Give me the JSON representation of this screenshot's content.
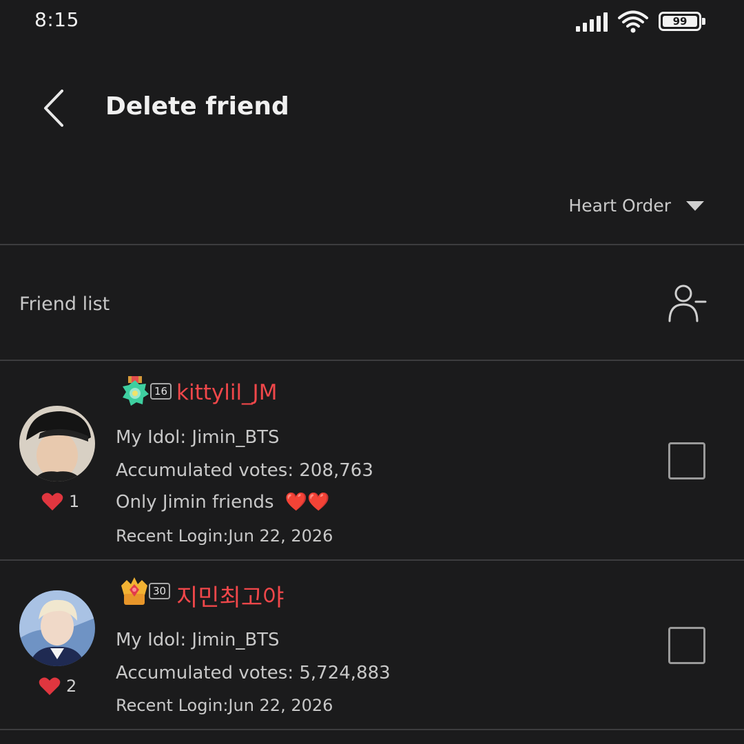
{
  "status_bar": {
    "time": "8:15",
    "battery": "99"
  },
  "header": {
    "title": "Delete friend"
  },
  "sort": {
    "label": "Heart Order"
  },
  "section": {
    "label": "Friend list"
  },
  "friends": [
    {
      "level": "16",
      "username": "kittylil_JM",
      "idol": "My Idol: Jimin_BTS",
      "votes": "Accumulated votes: 208,763",
      "status_message": "Only Jimin friends",
      "status_emoji": "❤️❤️",
      "recent_login": "Recent Login:Jun 22, 2026",
      "hearts": "1",
      "checked": false
    },
    {
      "level": "30",
      "username": "지민최고야",
      "idol": "My Idol: Jimin_BTS",
      "votes": "Accumulated votes: 5,724,883",
      "recent_login": "Recent Login:Jun 22, 2026",
      "hearts": "2",
      "checked": false
    }
  ],
  "colors": {
    "background": "#1b1b1c",
    "username": "#f0474a",
    "heart": "#e0363f",
    "divider": "#3d3d3f"
  }
}
